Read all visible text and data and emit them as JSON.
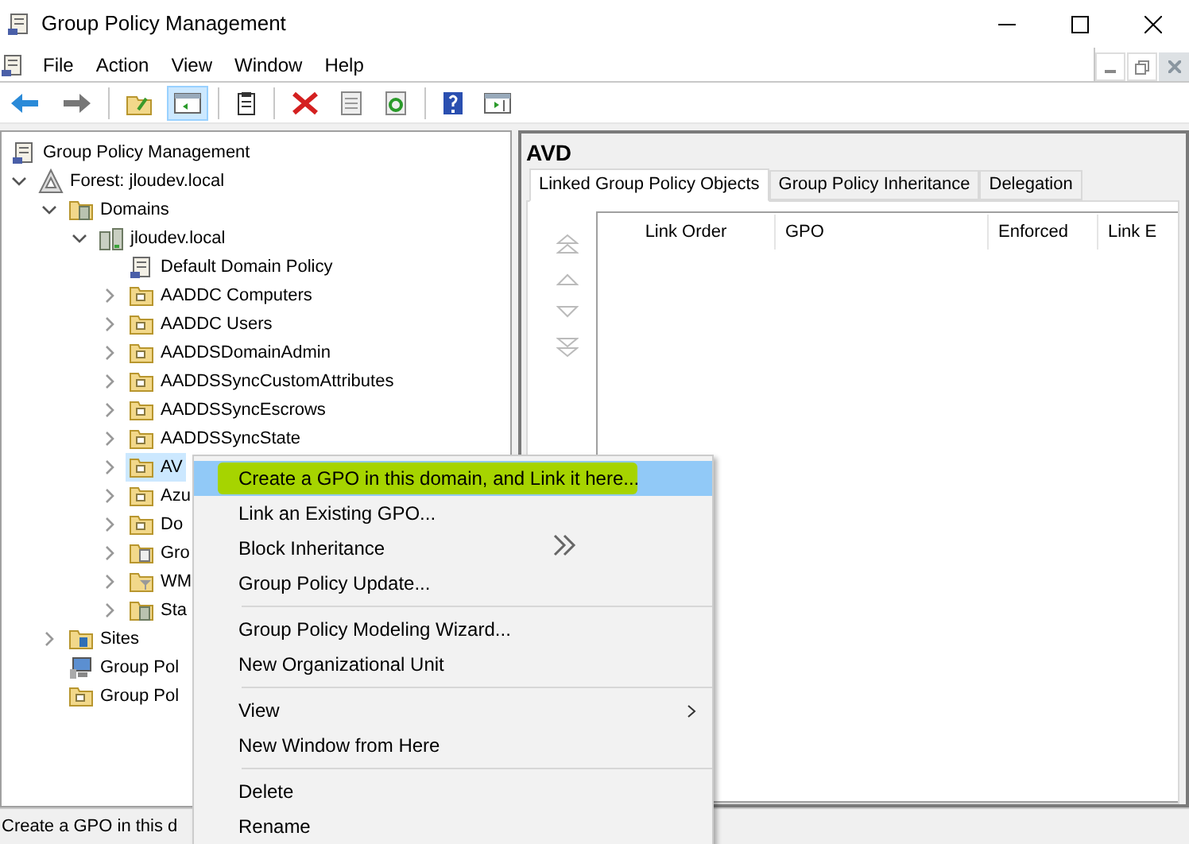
{
  "window": {
    "title": "Group Policy Management"
  },
  "menu_bar": [
    "File",
    "Action",
    "View",
    "Window",
    "Help"
  ],
  "toolbar": [
    {
      "kind": "back",
      "pressed": false
    },
    {
      "kind": "forward",
      "pressed": false
    },
    {
      "kind": "sep"
    },
    {
      "kind": "up",
      "pressed": false
    },
    {
      "kind": "tree",
      "pressed": true
    },
    {
      "kind": "sep"
    },
    {
      "kind": "export",
      "pressed": false
    },
    {
      "kind": "sep"
    },
    {
      "kind": "delete",
      "pressed": false
    },
    {
      "kind": "properties",
      "pressed": false
    },
    {
      "kind": "refresh",
      "pressed": false
    },
    {
      "kind": "sep"
    },
    {
      "kind": "help",
      "pressed": false
    },
    {
      "kind": "pane",
      "pressed": false
    }
  ],
  "tree": [
    {
      "label": "Group Policy Management",
      "kind": "console",
      "children": [
        {
          "label": "Forest: jloudev.local",
          "kind": "forest",
          "expanded": true,
          "children": [
            {
              "label": "Domains",
              "kind": "domains",
              "expanded": true,
              "children": [
                {
                  "label": "jloudev.local",
                  "kind": "domain",
                  "expanded": true,
                  "children": [
                    {
                      "label": "Default Domain Policy",
                      "kind": "gpo",
                      "selected": false
                    },
                    {
                      "label": "AADDC Computers",
                      "kind": "ou",
                      "expanded": false,
                      "selected": false
                    },
                    {
                      "label": "AADDC Users",
                      "kind": "ou",
                      "expanded": false,
                      "selected": false
                    },
                    {
                      "label": "AADDSDomainAdmin",
                      "kind": "ou",
                      "expanded": false,
                      "selected": false
                    },
                    {
                      "label": "AADDSSyncCustomAttributes",
                      "kind": "ou",
                      "expanded": false,
                      "selected": false
                    },
                    {
                      "label": "AADDSSyncEscrows",
                      "kind": "ou",
                      "expanded": false,
                      "selected": false
                    },
                    {
                      "label": "AADDSSyncState",
                      "kind": "ou",
                      "expanded": false,
                      "selected": false
                    },
                    {
                      "label": "AV",
                      "kind": "ou",
                      "expanded": false,
                      "selected": true
                    },
                    {
                      "label": "Azu",
                      "kind": "ou",
                      "expanded": false,
                      "selected": false
                    },
                    {
                      "label": "Do",
                      "kind": "ou",
                      "expanded": false,
                      "selected": false
                    },
                    {
                      "label": "Gro",
                      "kind": "gpos",
                      "expanded": false,
                      "selected": false
                    },
                    {
                      "label": "WM",
                      "kind": "wmi",
                      "expanded": false,
                      "selected": false
                    },
                    {
                      "label": "Sta",
                      "kind": "starter",
                      "expanded": false,
                      "selected": false
                    }
                  ]
                }
              ]
            },
            {
              "label": "Sites",
              "kind": "sites",
              "expanded": false,
              "selected": false
            },
            {
              "label": "Group Pol",
              "kind": "modeling",
              "selected": false
            },
            {
              "label": "Group Pol",
              "kind": "results",
              "selected": false
            }
          ]
        }
      ]
    }
  ],
  "details": {
    "heading": "AVD",
    "tabs": [
      {
        "label": "Linked Group Policy Objects",
        "selected": true
      },
      {
        "label": "Group Policy Inheritance",
        "selected": false
      },
      {
        "label": "Delegation",
        "selected": false
      }
    ],
    "columns": [
      "Link Order",
      "GPO",
      "Enforced",
      "Link E"
    ]
  },
  "context_menu": [
    {
      "kind": "item",
      "label": "Create a GPO in this domain, and Link it here...",
      "selected": true,
      "marker_highlight": true
    },
    {
      "kind": "item",
      "label": "Link an Existing GPO...",
      "selected": false
    },
    {
      "kind": "item",
      "label": "Block Inheritance",
      "selected": false
    },
    {
      "kind": "item",
      "label": "Group Policy Update...",
      "selected": false
    },
    {
      "kind": "separator"
    },
    {
      "kind": "item",
      "label": "Group Policy Modeling Wizard...",
      "selected": false
    },
    {
      "kind": "item",
      "label": "New Organizational Unit",
      "selected": false
    },
    {
      "kind": "separator"
    },
    {
      "kind": "item",
      "label": "View",
      "selected": false,
      "submenu": true
    },
    {
      "kind": "item",
      "label": "New Window from Here",
      "selected": false
    },
    {
      "kind": "separator"
    },
    {
      "kind": "item",
      "label": "Delete",
      "selected": false
    },
    {
      "kind": "item",
      "label": "Rename",
      "selected": false
    }
  ],
  "status_bar": "Create a GPO in this d"
}
